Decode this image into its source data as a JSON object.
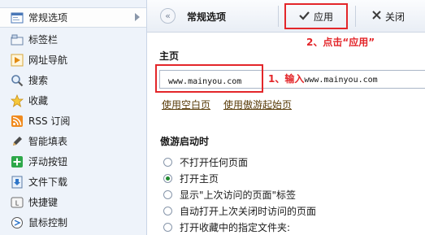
{
  "sidebar": {
    "items": [
      {
        "label": "常规选项",
        "icon": "settings-window-icon",
        "active": true
      },
      {
        "label": "标签栏",
        "icon": "tabs-icon"
      },
      {
        "label": "网址导航",
        "icon": "navigation-arrow-icon"
      },
      {
        "label": "搜索",
        "icon": "magnifier-icon"
      },
      {
        "label": "收藏",
        "icon": "star-icon"
      },
      {
        "label": "RSS 订阅",
        "icon": "rss-icon"
      },
      {
        "label": "智能填表",
        "icon": "pen-icon"
      },
      {
        "label": "浮动按钮",
        "icon": "plus-button-icon"
      },
      {
        "label": "文件下载",
        "icon": "download-arrow-icon"
      },
      {
        "label": "快捷键",
        "icon": "keyboard-key-icon"
      },
      {
        "label": "鼠标控制",
        "icon": "mouse-gesture-icon"
      }
    ]
  },
  "toolbar": {
    "title": "常规选项",
    "back_symbol": "«",
    "apply_label": "应用",
    "close_label": "关闭"
  },
  "homepage": {
    "section_title": "主页",
    "url_value": "www.mainyou.com",
    "link_blank": "使用空白页",
    "link_maxthon": "使用傲游起始页"
  },
  "startup": {
    "section_title": "傲游启动时",
    "options": [
      {
        "label": "不打开任何页面",
        "checked": false
      },
      {
        "label": "打开主页",
        "checked": true
      },
      {
        "label": "显示\"上次访问的页面\"标签",
        "checked": false
      },
      {
        "label": "自动打开上次关闭时访问的页面",
        "checked": false
      },
      {
        "label": "打开收藏中的指定文件夹:",
        "checked": false
      }
    ]
  },
  "annotations": {
    "step1_label": "1、输入",
    "step1_url": "www.mainyou.com",
    "step2": "2、点击“应用”",
    "color": "#e3262a"
  }
}
